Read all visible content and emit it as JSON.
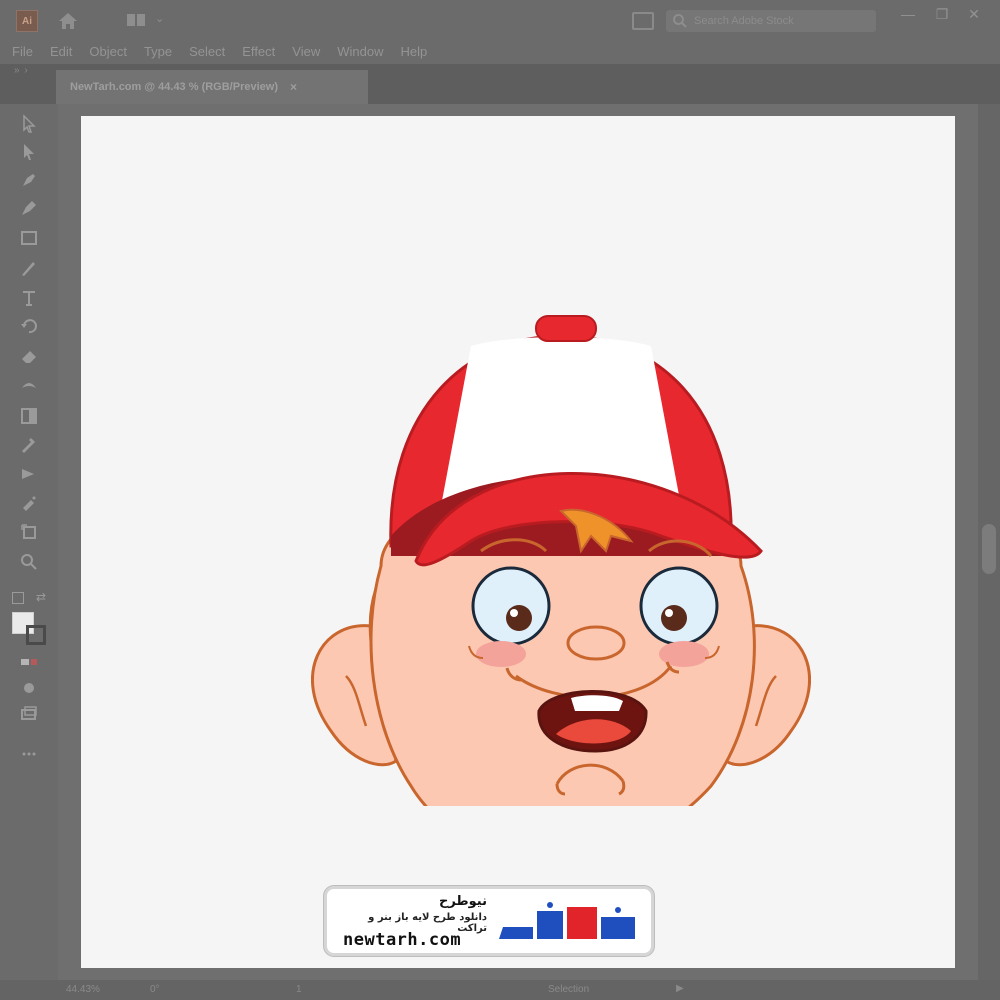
{
  "app": {
    "logo_text": "Ai",
    "search_placeholder": "Search Adobe Stock"
  },
  "menu": {
    "items": [
      "File",
      "Edit",
      "Object",
      "Type",
      "Select",
      "Effect",
      "View",
      "Window",
      "Help"
    ]
  },
  "document": {
    "tab_label": "NewTarh.com @ 44.43 % (RGB/Preview)",
    "close_glyph": "×"
  },
  "window_controls": {
    "minimize": "—",
    "restore": "❐",
    "close": "✕"
  },
  "status": {
    "zoom": "44.43%",
    "angle": "0°",
    "page": "1",
    "mode": "Selection",
    "play": "▶"
  },
  "watermark": {
    "title": "نیوطرح",
    "subtitle": "دانلود طرح لایه باز بنر و تراکت",
    "domain": "newtarh.com",
    "logo_text": "نیوطرح"
  },
  "icons": {
    "tools": [
      "select-arrow",
      "direct-select-arrow",
      "pen",
      "curvature-pen",
      "rectangle",
      "paintbrush",
      "type",
      "rotate",
      "eraser",
      "width",
      "gradient",
      "eyedropper",
      "blend",
      "symbol-sprayer",
      "artboard",
      "zoom",
      "hand"
    ]
  },
  "colors": {
    "cap_red": "#e8282f",
    "cap_white": "#ffffff",
    "hair": "#f0922a",
    "skin": "#fcc8b2",
    "outline": "#c9662e",
    "brand_blue": "#1f4fbf",
    "brand_red": "#e0242a"
  }
}
